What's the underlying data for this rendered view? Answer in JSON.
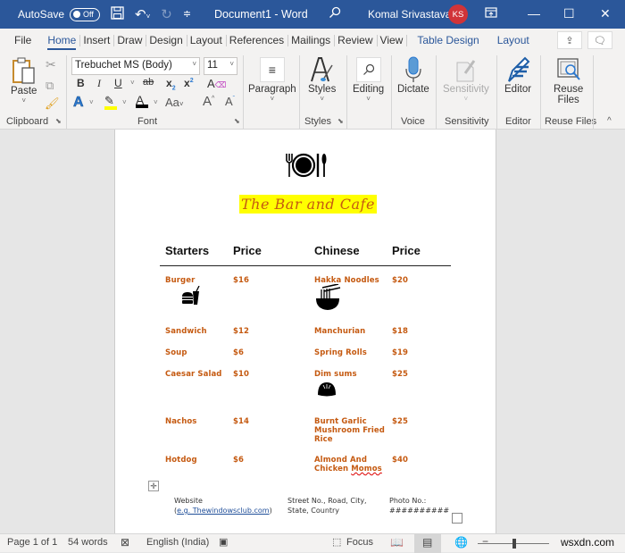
{
  "titlebar": {
    "autosave_label": "AutoSave",
    "autosave_state": "Off",
    "document_title": "Document1 - Word",
    "user_name": "Komal Srivastava",
    "user_initials": "KS",
    "icons": [
      "save-icon",
      "undo-icon",
      "redo-icon",
      "customize-qat-icon",
      "search-icon",
      "ribbon-display-icon",
      "minimize-icon",
      "maximize-icon",
      "close-icon"
    ]
  },
  "tabs": [
    {
      "label": "File"
    },
    {
      "label": "Home",
      "active": true
    },
    {
      "label": "Insert"
    },
    {
      "label": "Draw"
    },
    {
      "label": "Design"
    },
    {
      "label": "Layout"
    },
    {
      "label": "References"
    },
    {
      "label": "Mailings"
    },
    {
      "label": "Review"
    },
    {
      "label": "View"
    },
    {
      "label": "Table Design",
      "contextual": true
    },
    {
      "label": "Layout",
      "contextual": true
    }
  ],
  "ribbon": {
    "clipboard": {
      "paste_label": "Paste",
      "group_label": "Clipboard"
    },
    "font": {
      "font_name": "Trebuchet MS (Body)",
      "font_size": "11",
      "group_label": "Font",
      "buttons": [
        "B",
        "I",
        "U",
        "ab",
        "x₂",
        "x²",
        "Aa"
      ]
    },
    "paragraph": {
      "label": "Paragraph"
    },
    "styles": {
      "label": "Styles",
      "group_label": "Styles"
    },
    "editing": {
      "label": "Editing"
    },
    "voice": {
      "label": "Dictate",
      "group_label": "Voice"
    },
    "sensitivity": {
      "label": "Sensitivity",
      "group_label": "Sensitivity"
    },
    "editor": {
      "label": "Editor",
      "group_label": "Editor"
    },
    "reuse": {
      "label_line1": "Reuse",
      "label_line2": "Files",
      "group_label": "Reuse Files"
    }
  },
  "document": {
    "title": "The Bar and Cafe",
    "headers": [
      "Starters",
      "Price",
      "Chinese",
      "Price"
    ],
    "starters": [
      {
        "name": "Burger",
        "price": "$16"
      },
      {
        "name": "Sandwich",
        "price": "$12"
      },
      {
        "name": "Soup",
        "price": "$6"
      },
      {
        "name": "Caesar Salad",
        "price": "$10"
      },
      {
        "name": "Nachos",
        "price": "$14"
      },
      {
        "name": "Hotdog",
        "price": "$6"
      }
    ],
    "chinese": [
      {
        "name": "Hakka Noodles",
        "price": "$20"
      },
      {
        "name": "Manchurian",
        "price": "$18"
      },
      {
        "name": "Spring Rolls",
        "price": "$19"
      },
      {
        "name": "Dim sums",
        "price": "$25"
      },
      {
        "name_lines": [
          "Burnt Garlic",
          "Mushroom Fried",
          "Rice"
        ],
        "price": "$25"
      },
      {
        "name_lines": [
          "Almond And",
          "Chicken Momos"
        ],
        "price": "$40"
      }
    ],
    "footer": {
      "website_label": "Website",
      "website_value": "(e.g. Thewindowsclub.com)",
      "website_link": "e.g. Thewindowsclub.com",
      "address_line1": "Street No., Road, City,",
      "address_line2": "State, Country",
      "phone_label": "Photo No.:",
      "phone_value": "##########"
    }
  },
  "statusbar": {
    "page": "Page 1 of 1",
    "words": "54 words",
    "language": "English (India)",
    "focus": "Focus",
    "zoom_label": "wsxdn.com"
  },
  "colors": {
    "titlebar": "#2b579a",
    "menu_text": "#c55a11",
    "highlight": "#ffff00",
    "avatar": "#d13438"
  }
}
